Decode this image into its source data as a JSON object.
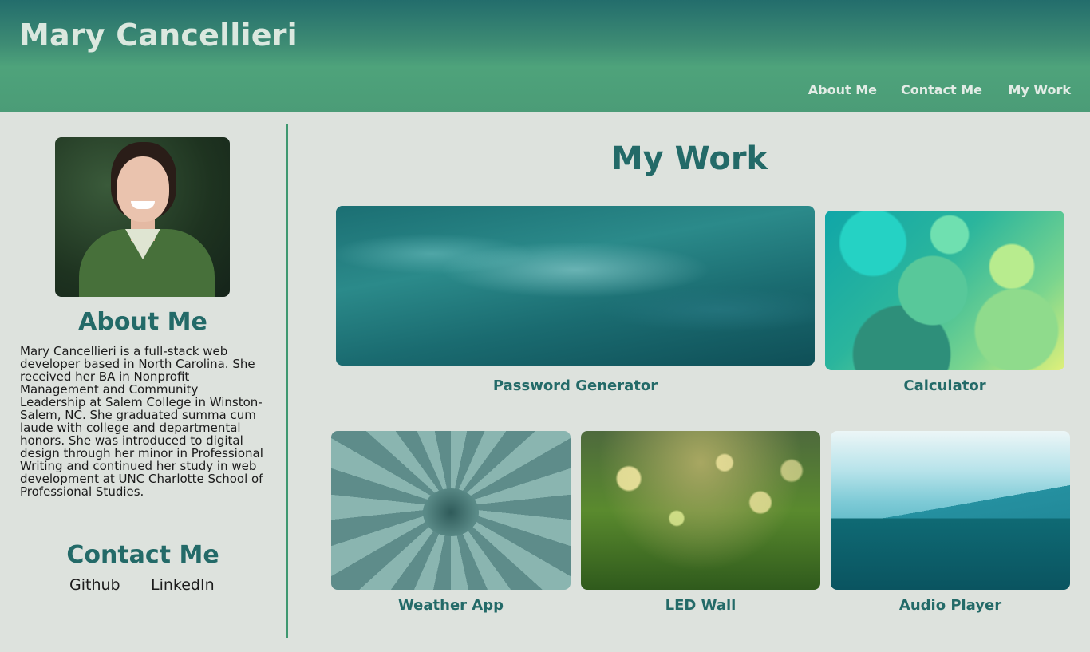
{
  "header": {
    "title": "Mary Cancellieri",
    "nav": [
      "About Me",
      "Contact Me",
      "My Work"
    ]
  },
  "sidebar": {
    "about_heading": "About Me",
    "about_text": "Mary Cancellieri is a full-stack web developer based in North Carolina. She received her BA in Nonprofit Management and Community Leadership at Salem College in Winston-Salem, NC. She graduated summa cum laude with college and departmental honors. She was introduced to digital design through her minor in Professional Writing and continued her study in web development at UNC Charlotte School of Professional Studies.",
    "contact_heading": "Contact Me",
    "links": [
      "Github",
      "LinkedIn"
    ]
  },
  "work": {
    "title": "My Work",
    "projects": [
      {
        "name": "Password Generator",
        "thumb": "teal-water"
      },
      {
        "name": "Calculator",
        "thumb": "green-bubbles"
      },
      {
        "name": "Weather App",
        "thumb": "succulent"
      },
      {
        "name": "LED Wall",
        "thumb": "dewy-grass"
      },
      {
        "name": "Audio Player",
        "thumb": "blue-mountains"
      }
    ]
  },
  "colors": {
    "accent": "#236a68",
    "header_top": "#236d6c",
    "header_bottom": "#4ea37b",
    "background": "#dde2dd",
    "divider": "#3e9870"
  }
}
